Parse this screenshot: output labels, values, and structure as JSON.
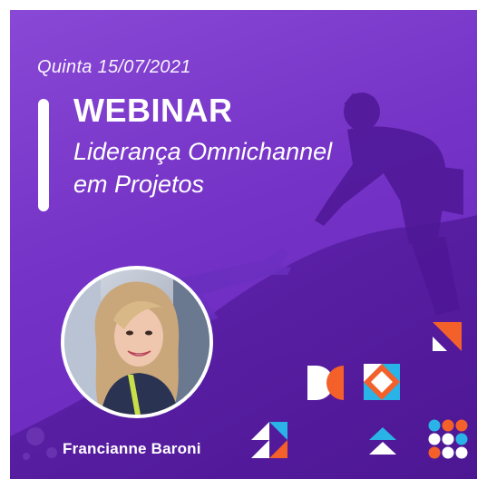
{
  "event": {
    "date": "Quinta  15/07/2021",
    "type": "WEBINAR",
    "title_line1": "Liderança Omnichannel",
    "title_line2": "em Projetos"
  },
  "speaker": {
    "name": "Francianne Baroni"
  },
  "colors": {
    "background": "#7432c6",
    "accent_orange": "#f4602a",
    "accent_blue": "#2ab3e6",
    "text": "#ffffff"
  },
  "icons": [
    "hands-silhouette-art",
    "speaker-photo",
    "brand-shape-arrow",
    "brand-shape-dc",
    "brand-shape-diamond",
    "brand-shape-triangles",
    "brand-shape-chevrons",
    "brand-shape-dots"
  ]
}
